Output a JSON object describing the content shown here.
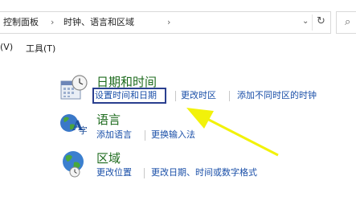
{
  "address_bar": {
    "breadcrumb_root": "控制面板",
    "breadcrumb_current": "时钟、语言和区域",
    "separator": "›",
    "dropdown_glyph": "⌄",
    "refresh_glyph": "↻"
  },
  "search": {
    "icon_glyph": "⌕"
  },
  "menu": {
    "view_fragment": "(V)",
    "tools": "工具(T)"
  },
  "categories": [
    {
      "title": "日期和时间",
      "icon": "calendar-clock-icon",
      "links": [
        "设置时间和日期",
        "更改时区",
        "添加不同时区的时钟"
      ]
    },
    {
      "title": "语言",
      "icon": "language-icon",
      "links": [
        "添加语言",
        "更换输入法"
      ]
    },
    {
      "title": "区域",
      "icon": "globe-clock-icon",
      "links": [
        "更改位置",
        "更改日期、时间或数字格式"
      ]
    }
  ],
  "colors": {
    "category_title": "#1e6b1e",
    "link": "#1a4fa8",
    "highlight_box": "#2a3f8f",
    "annotation_arrow": "#f2f20a"
  }
}
